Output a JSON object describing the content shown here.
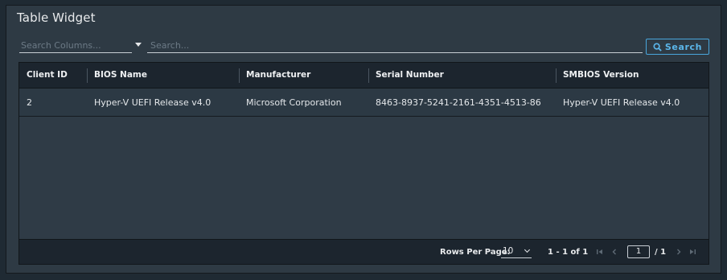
{
  "widget": {
    "title": "Table Widget"
  },
  "search": {
    "column_placeholder": "Search Columns...",
    "text_placeholder": "Search...",
    "button_label": "Search"
  },
  "table": {
    "columns": [
      "Client ID",
      "BIOS Name",
      "Manufacturer",
      "Serial Number",
      "SMBIOS Version"
    ],
    "rows": [
      [
        "2",
        "Hyper-V UEFI Release v4.0",
        "Microsoft Corporation",
        "8463-8937-5241-2161-4351-4513-86",
        "Hyper-V UEFI Release v4.0"
      ]
    ]
  },
  "pagination": {
    "rows_per_page_label": "Rows Per Page:",
    "rows_per_page": "10",
    "range": "1 - 1 of 1",
    "current_page": "1",
    "total_pages": "/ 1"
  },
  "icons": {
    "search": "magnifier-icon",
    "first": "first-page-icon",
    "prev": "prev-page-icon",
    "next": "next-page-icon",
    "last": "last-page-icon"
  },
  "colors": {
    "accent": "#49a6dc",
    "panel": "#2e3a44",
    "header": "#1c252e"
  }
}
